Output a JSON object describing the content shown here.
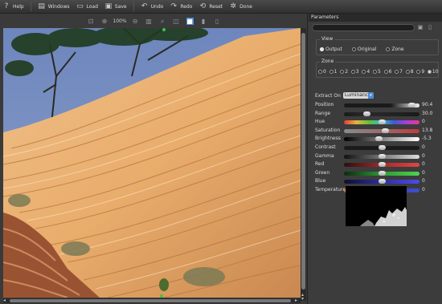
{
  "toolbar": {
    "help": "Help",
    "windows": "Windows",
    "load": "Load",
    "save": "Save",
    "undo": "Undo",
    "redo": "Redo",
    "reset": "Reset",
    "done": "Done"
  },
  "viewer": {
    "zoom": "100%"
  },
  "panel": {
    "title": "Parameters",
    "view": {
      "title": "View",
      "options": [
        "Output",
        "Original",
        "Zone"
      ],
      "selected": "Output"
    },
    "zone": {
      "title": "Zone",
      "options": [
        "0",
        "1",
        "2",
        "3",
        "4",
        "5",
        "6",
        "7",
        "8",
        "9",
        "10"
      ],
      "selected": "10"
    },
    "extract": {
      "label": "Extract On",
      "value": "Luminance"
    },
    "params": [
      {
        "label": "Position",
        "value": "90.4",
        "fraction": 0.9
      },
      {
        "label": "Range",
        "value": "30.0",
        "fraction": 0.3
      },
      {
        "label": "Hue",
        "value": "0",
        "fraction": 0.5
      },
      {
        "label": "Saturation",
        "value": "13.8",
        "fraction": 0.55
      },
      {
        "label": "Brightness",
        "value": "-5.3",
        "fraction": 0.46
      },
      {
        "label": "Contrast",
        "value": "0",
        "fraction": 0.5
      },
      {
        "label": "Gamma",
        "value": "0",
        "fraction": 0.5
      },
      {
        "label": "Red",
        "value": "0",
        "fraction": 0.5
      },
      {
        "label": "Green",
        "value": "0",
        "fraction": 0.5
      },
      {
        "label": "Blue",
        "value": "0",
        "fraction": 0.5
      },
      {
        "label": "Temperature",
        "value": "0",
        "fraction": 0.5
      }
    ]
  },
  "colors": {
    "accent": "#4b8fd6",
    "panel_bg": "#3c3c3c"
  }
}
